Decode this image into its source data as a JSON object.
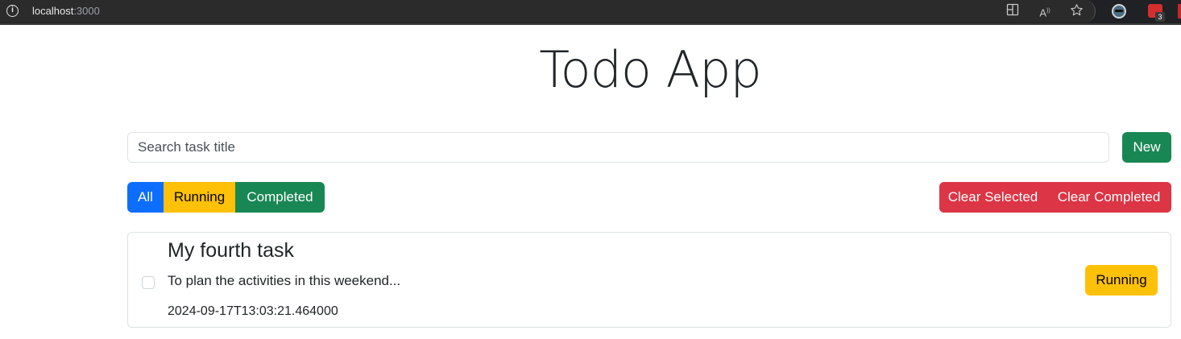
{
  "browser": {
    "url_host": "localhost",
    "url_port": ":3000",
    "ext_badge": "3",
    "icons": [
      "info-icon",
      "split-screen-icon",
      "read-aloud-icon",
      "favorite-star-icon",
      "extension-avatar-icon",
      "extension-red-icon"
    ]
  },
  "app": {
    "title": "Todo App"
  },
  "search": {
    "placeholder": "Search task title",
    "value": ""
  },
  "toolbar": {
    "new_label": "New"
  },
  "filters": {
    "all": "All",
    "running": "Running",
    "completed": "Completed"
  },
  "clear": {
    "selected": "Clear Selected",
    "completed": "Clear Completed"
  },
  "tasks": [
    {
      "title": "My fourth task",
      "description": "To plan the activities in this weekend...",
      "created": "2024-09-17T13:03:21.464000",
      "status": "Running",
      "checked": false
    }
  ],
  "colors": {
    "primary": "#0d6efd",
    "warning": "#ffc107",
    "success": "#198754",
    "danger": "#dc3545"
  }
}
